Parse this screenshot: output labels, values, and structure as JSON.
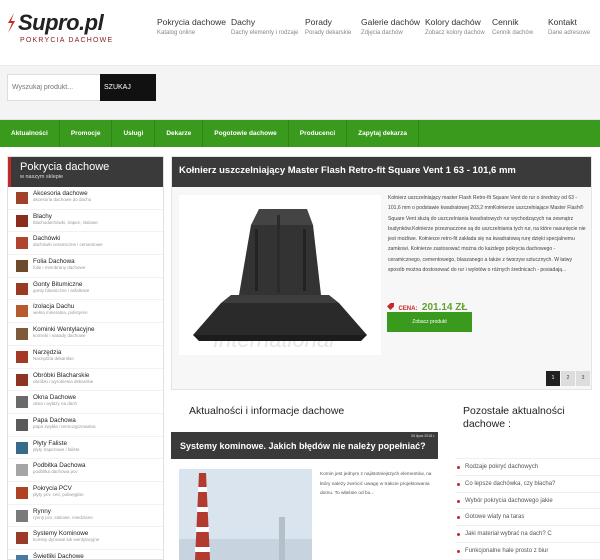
{
  "brand": {
    "name": "Supro.pl",
    "tagline": "POKRYCIA DACHOWE",
    "accent_red": "#c62828",
    "accent_green": "#3a9a1e"
  },
  "top_nav": [
    {
      "title": "Pokrycia dachowe",
      "subtitle": "Katalog online"
    },
    {
      "title": "Dachy",
      "subtitle": "Dachy elementy i rodzaje"
    },
    {
      "title": "Porady",
      "subtitle": "Porady dekarskie"
    },
    {
      "title": "Galerie dachów",
      "subtitle": "Zdjęcia dachów"
    },
    {
      "title": "Kolory dachów",
      "subtitle": "Zobacz kolory dachów"
    },
    {
      "title": "Cennik",
      "subtitle": "Cennik dachów"
    },
    {
      "title": "Kontakt",
      "subtitle": "Dane adresowe"
    }
  ],
  "search": {
    "placeholder": "Wyszukaj produkt...",
    "button": "SZUKAJ"
  },
  "green_nav": [
    "Aktualności",
    "Promocje",
    "Usługi",
    "Dekarze",
    "Pogotowie dachowe",
    "Producenci",
    "Zapytaj dekarza"
  ],
  "sidebar": {
    "title": "Pokrycia dachowe",
    "subtitle": "w naszym sklepie",
    "categories": [
      {
        "name": "Akcesoria dachowe",
        "desc": "akcesoria dachowe do dachu"
      },
      {
        "name": "Blachy",
        "desc": "blachodachówki, trapez, stalowe"
      },
      {
        "name": "Dachówki",
        "desc": "dachówki ceramiczne i cementowe"
      },
      {
        "name": "Folia Dachowa",
        "desc": "folie i membrany dachowe"
      },
      {
        "name": "Gonty Bitumiczne",
        "desc": "gonty bitumiczne i asfaltowe"
      },
      {
        "name": "Izolacja Dachu",
        "desc": "wełna mineralna, polistyren"
      },
      {
        "name": "Kominki Wentylacyjne",
        "desc": "kominki i nasady dachowe"
      },
      {
        "name": "Narzędzia",
        "desc": "Narzędzia dekarskie"
      },
      {
        "name": "Obróbki Blacharskie",
        "desc": "obróbki i wyrobienia dekarskie"
      },
      {
        "name": "Okna Dachowe",
        "desc": "okna i wyłazy na dach"
      },
      {
        "name": "Papa Dachowa",
        "desc": "papa zwykła i termozgrzewalna"
      },
      {
        "name": "Płyty Faliste",
        "desc": "płyty trapezowe i faliste"
      },
      {
        "name": "Podbitka Dachowa",
        "desc": "podbitka dachowa pcv"
      },
      {
        "name": "Pokrycia PCV",
        "desc": "płyty pcv, ceti, poliwęglan"
      },
      {
        "name": "Rynny",
        "desc": "rynny pcv, stalowe, miedziane"
      },
      {
        "name": "Systemy Kominowe",
        "desc": "kominy dymowe luk wentylacyjne"
      },
      {
        "name": "Świetliki Dachowe",
        "desc": "doświetlenie dachów"
      }
    ]
  },
  "product": {
    "title": "Kołnierz uszczelniający Master Flash Retro-fit Square Vent 1 63 - 101,6 mm",
    "image_watermark": "International",
    "description": "Kołnierz uszczelniający master Flash Retro-fit Square Vent do rur o średnicy od 63 - 101,6 mm o podstawie kwadratowej 203,2 mmKołnierze uszczelniające Master Flash® Square Vent służą do uszczelniania kwadratowych rur wychodzących na zewnątrz budynków.Kołnierze przeznaczone są do uszczelniania tych rur, na które nasunięcie nie jest możliwe. Kołnierze retro-fit zakłada się na kwadratową rurę dzięki specjalnemu zamkowi. Kołnierze zastosować można do każdego pokrycia dachowego - ceramicznego, cementowego, blaszanego a także z tworzyw sztucznych. W łatwy sposób można dostosować do rur i wylotów o różnych średnicach - posiadają...",
    "price_label": "CENA:",
    "price": "201.14 ZŁ",
    "button": "Zobacz produkt",
    "pages": [
      "1",
      "2",
      "3"
    ],
    "active_page": "1"
  },
  "news": {
    "heading": "Aktualności i informacje dachowe",
    "article_title": "Systemy kominowe. Jakich błędów nie należy popełniać?",
    "article_date": "06 lipca 2018 r.",
    "article_text": "Komin jest jednym z najistotniejszych elementów, na który należy zwrócić uwagę w trakcie projektowania domu. To właśnie od bu..."
  },
  "other_news": {
    "heading": "Pozostałe aktualności dachowe :",
    "items": [
      "Rodzaje pokryć dachowych",
      "Co lepsze dachówka, czy blacha?",
      "Wybór pokrycia dachowego jakie",
      "Gotowe wiaty na taras",
      "Jaki materiał wybrać na dach? C",
      "Funkcjonalne hale prosto z biur",
      "Cennik usług dekarskich 2016"
    ]
  }
}
